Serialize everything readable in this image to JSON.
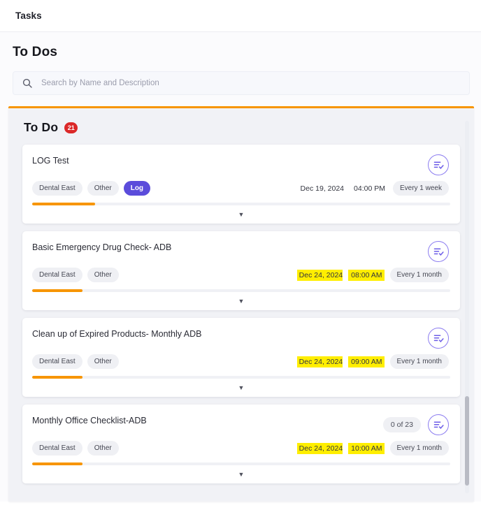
{
  "header": {
    "title": "Tasks"
  },
  "section": {
    "title": "To Dos"
  },
  "search": {
    "placeholder": "Search by Name and Description",
    "value": "",
    "icon": "search-icon"
  },
  "todo_panel": {
    "title": "To Do",
    "badge_count": "21",
    "accent_color": "#f79500",
    "badge_color": "#db2828",
    "expand_icon": "chevron-down-icon",
    "action_icon": "list-check-icon",
    "tasks": [
      {
        "title": "LOG Test",
        "tags": [
          {
            "label": "Dental East",
            "accent": false
          },
          {
            "label": "Other",
            "accent": false
          },
          {
            "label": "Log",
            "accent": true
          }
        ],
        "due_date": "Dec 19, 2024",
        "due_time": "04:00 PM",
        "due_highlighted": false,
        "recurrence": "Every 1 week",
        "progress_percent": 15,
        "counter": ""
      },
      {
        "title": "Basic Emergency Drug Check- ADB",
        "tags": [
          {
            "label": "Dental East",
            "accent": false
          },
          {
            "label": "Other",
            "accent": false
          }
        ],
        "due_date": "Dec 24, 2024",
        "due_time": "08:00 AM",
        "due_highlighted": true,
        "recurrence": "Every 1 month",
        "progress_percent": 12,
        "counter": ""
      },
      {
        "title": "Clean up of Expired Products- Monthly ADB",
        "tags": [
          {
            "label": "Dental East",
            "accent": false
          },
          {
            "label": "Other",
            "accent": false
          }
        ],
        "due_date": "Dec 24, 2024",
        "due_time": "09:00 AM",
        "due_highlighted": true,
        "recurrence": "Every 1 month",
        "progress_percent": 12,
        "counter": ""
      },
      {
        "title": "Monthly Office Checklist-ADB",
        "tags": [
          {
            "label": "Dental East",
            "accent": false
          },
          {
            "label": "Other",
            "accent": false
          }
        ],
        "due_date": "Dec 24, 2024",
        "due_time": "10:00 AM",
        "due_highlighted": true,
        "recurrence": "Every 1 month",
        "progress_percent": 12,
        "counter": "0 of 23"
      }
    ]
  }
}
